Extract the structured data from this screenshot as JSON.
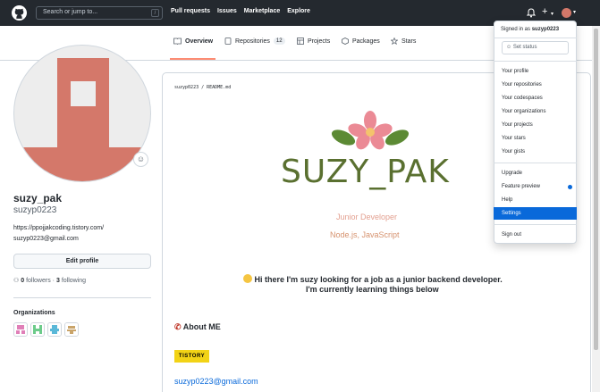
{
  "header": {
    "search_placeholder": "Search or jump to...",
    "search_key": "/",
    "nav": [
      "Pull requests",
      "Issues",
      "Marketplace",
      "Explore"
    ],
    "plus_label": "+",
    "bell_icon": "bell-icon"
  },
  "tabs": [
    {
      "label": "Overview",
      "icon": "book-icon"
    },
    {
      "label": "Repositories",
      "icon": "repo-icon",
      "count": "12"
    },
    {
      "label": "Projects",
      "icon": "table-icon"
    },
    {
      "label": "Packages",
      "icon": "package-icon"
    },
    {
      "label": "Stars",
      "icon": "star-icon"
    }
  ],
  "profile": {
    "fullname": "suzy_pak",
    "username": "suzyp0223",
    "blog": "https://ppojjakcoding.tistory.com/",
    "email": "suzyp0223@gmail.com",
    "edit_label": "Edit profile",
    "followers_count": "0",
    "followers_label": "followers",
    "following_count": "3",
    "following_label": "following",
    "orgs_title": "Organizations"
  },
  "readme": {
    "path": "suzyp0223 / README.md",
    "title": "SUZY_PAK",
    "subtitle1": "Junior Developer",
    "subtitle2": "Node.js, JavaScript",
    "intro1": "Hi there I'm suzy looking for a job as a junior backend developer.",
    "intro2": "I'm currently learning things below",
    "about": "About ME",
    "badge": "TISTORY",
    "email": "suzyp0223@gmail.com"
  },
  "dropdown": {
    "signed_in_prefix": "Signed in as ",
    "signed_in_user": "suzyp0223",
    "set_status": "Set status",
    "group1": [
      "Your profile",
      "Your repositories",
      "Your codespaces",
      "Your organizations",
      "Your projects",
      "Your stars",
      "Your gists"
    ],
    "group2": [
      "Upgrade",
      "Feature preview",
      "Help",
      "Settings"
    ],
    "sign_out": "Sign out",
    "active_item": "Settings"
  },
  "colors": {
    "header_bg": "#24292f",
    "accent_blue": "#0969da",
    "tab_underline": "#fd8c73",
    "title_green": "#5a7030",
    "badge_yellow": "#f2d316"
  }
}
